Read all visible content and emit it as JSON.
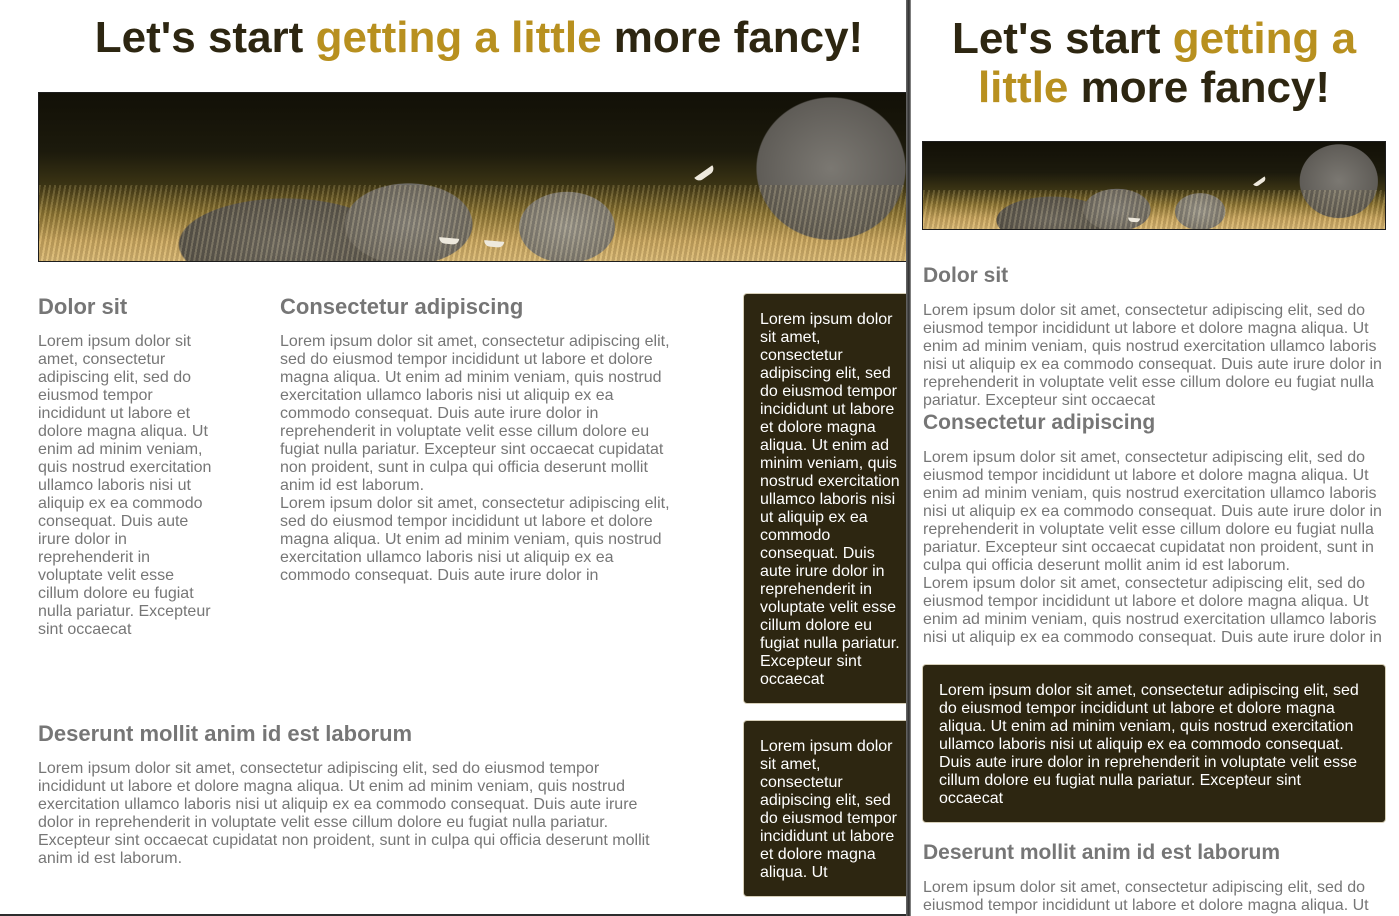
{
  "heading": {
    "start": "Let's start ",
    "accent": "getting a little",
    "end": " more fancy!"
  },
  "heading_right": {
    "start": "Let's start ",
    "accent": "getting a little",
    "end": " more fancy!"
  },
  "hero_image": {
    "subject": "elephants in savanna grass",
    "colors": {
      "dark": "#121007",
      "grass": "#c9a661"
    }
  },
  "sections": {
    "dolor": {
      "title": "Dolor sit",
      "text": "Lorem ipsum dolor sit amet, consectetur adipiscing elit, sed do eiusmod tempor incididunt ut labore et dolore magna aliqua. Ut enim ad minim veniam, quis nostrud exercitation ullamco laboris nisi ut aliquip ex ea commodo consequat. Duis aute irure dolor in reprehenderit in voluptate velit esse cillum dolore eu fugiat nulla pariatur. Excepteur sint occaecat"
    },
    "consectetur": {
      "title": "Consectetur adipiscing",
      "text1": "Lorem ipsum dolor sit amet, consectetur adipiscing elit, sed do eiusmod tempor incididunt ut labore et dolore magna aliqua. Ut enim ad minim veniam, quis nostrud exercitation ullamco laboris nisi ut aliquip ex ea commodo consequat. Duis aute irure dolor in reprehenderit in voluptate velit esse cillum dolore eu fugiat nulla pariatur. Excepteur sint occaecat cupidatat non proident, sunt in culpa qui officia deserunt mollit anim id est laborum.",
      "text2": "Lorem ipsum dolor sit amet, consectetur adipiscing elit, sed do eiusmod tempor incididunt ut labore et dolore magna aliqua. Ut enim ad minim veniam, quis nostrud exercitation ullamco laboris nisi ut aliquip ex ea commodo consequat. Duis aute irure dolor in"
    },
    "deserunt": {
      "title": "Deserunt mollit anim id est laborum",
      "text": "Lorem ipsum dolor sit amet, consectetur adipiscing elit, sed do eiusmod tempor incididunt ut labore et dolore magna aliqua. Ut enim ad minim veniam, quis nostrud exercitation ullamco laboris nisi ut aliquip ex ea commodo consequat. Duis aute irure dolor in reprehenderit in voluptate velit esse cillum dolore eu fugiat nulla pariatur. Excepteur sint occaecat cupidatat non proident, sunt in culpa qui officia deserunt mollit anim id est laborum."
    },
    "deserunt_right_visible": "Lorem ipsum dolor sit amet, consectetur adipiscing elit, sed do eiusmod tempor incididunt ut labore et dolore magna aliqua. Ut"
  },
  "cards": {
    "card1": "Lorem ipsum dolor sit amet, consectetur adipiscing elit, sed do eiusmod tempor incididunt ut labore et dolore magna aliqua. Ut enim ad minim veniam, quis nostrud exercitation ullamco laboris nisi ut aliquip ex ea commodo consequat. Duis aute irure dolor in reprehenderit in voluptate velit esse cillum dolore eu fugiat nulla pariatur. Excepteur sint occaecat",
    "card2": "Lorem ipsum dolor sit amet, consectetur adipiscing elit, sed do eiusmod tempor incididunt ut labore et dolore magna aliqua. Ut"
  },
  "colors": {
    "heading": "#2d2611",
    "accent": "#b8901f",
    "text": "#767676",
    "card_bg": "#2d2611"
  }
}
